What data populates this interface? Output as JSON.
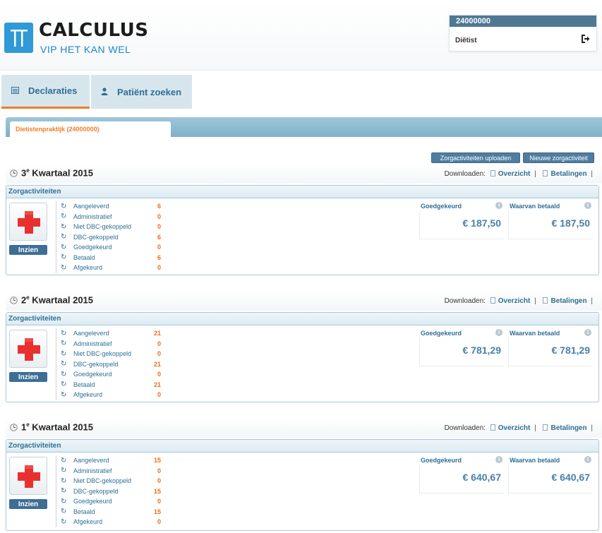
{
  "header": {
    "logo_title": "CALCULUS",
    "logo_sub_part1": "VIP",
    "logo_sub_part2": "HET KAN WEL",
    "user_id": "24000000",
    "user_role": "Diëtist",
    "logout_icon": "logout-icon"
  },
  "tabs": [
    {
      "label": "Declaraties",
      "icon": "list-icon",
      "active": true
    },
    {
      "label": "Patiënt zoeken",
      "icon": "user-icon",
      "active": false
    }
  ],
  "practice": {
    "label": "Dietistenpraktijk",
    "id": "(24000000)"
  },
  "actions": {
    "upload_label": "Zorgactiviteiten uploaden",
    "new_label": "Nieuwe zorgactiviteit"
  },
  "quarters": [
    {
      "num": "3",
      "sup": "e",
      "title": " Kwartaal 2015",
      "downloads_label": "Downloaden:",
      "overzicht": "Overzicht",
      "betalingen": "Betalingen",
      "panel_title": "Zorgactiviteiten",
      "inzien": "Inzien",
      "statuses": [
        {
          "label": "Aangeleverd",
          "value": "6"
        },
        {
          "label": "Administratief",
          "value": "0"
        },
        {
          "label": "Niet DBC-gekoppeld",
          "value": "0"
        },
        {
          "label": "DBC-gekoppeld",
          "value": "6"
        },
        {
          "label": "Goedgekeurd",
          "value": "0"
        },
        {
          "label": "Betaald",
          "value": "6"
        },
        {
          "label": "Afgekeurd",
          "value": "0"
        }
      ],
      "approved_label": "Goedgekeurd",
      "approved_amount": "€ 187,50",
      "paid_label": "Waarvan betaald",
      "paid_amount": "€ 187,50"
    },
    {
      "num": "2",
      "sup": "e",
      "title": " Kwartaal 2015",
      "downloads_label": "Downloaden:",
      "overzicht": "Overzicht",
      "betalingen": "Betalingen",
      "panel_title": "Zorgactiviteiten",
      "inzien": "Inzien",
      "statuses": [
        {
          "label": "Aangeleverd",
          "value": "21"
        },
        {
          "label": "Administratief",
          "value": "0"
        },
        {
          "label": "Niet DBC-gekoppeld",
          "value": "0"
        },
        {
          "label": "DBC-gekoppeld",
          "value": "21"
        },
        {
          "label": "Goedgekeurd",
          "value": "0"
        },
        {
          "label": "Betaald",
          "value": "21"
        },
        {
          "label": "Afgekeurd",
          "value": "0"
        }
      ],
      "approved_label": "Goedgekeurd",
      "approved_amount": "€ 781,29",
      "paid_label": "Waarvan betaald",
      "paid_amount": "€ 781,29"
    },
    {
      "num": "1",
      "sup": "e",
      "title": " Kwartaal 2015",
      "downloads_label": "Downloaden:",
      "overzicht": "Overzicht",
      "betalingen": "Betalingen",
      "panel_title": "Zorgactiviteiten",
      "inzien": "Inzien",
      "statuses": [
        {
          "label": "Aangeleverd",
          "value": "15"
        },
        {
          "label": "Administratief",
          "value": "0"
        },
        {
          "label": "Niet DBC-gekoppeld",
          "value": "0"
        },
        {
          "label": "DBC-gekoppeld",
          "value": "15"
        },
        {
          "label": "Goedgekeurd",
          "value": "0"
        },
        {
          "label": "Betaald",
          "value": "15"
        },
        {
          "label": "Afgekeurd",
          "value": "0"
        }
      ],
      "approved_label": "Goedgekeurd",
      "approved_amount": "€ 640,67",
      "paid_label": "Waarvan betaald",
      "paid_amount": "€ 640,67"
    }
  ],
  "colors": {
    "accent_orange": "#ef7d2a",
    "brand_blue": "#2f9ad6",
    "nav_blue": "#2d6f96",
    "button_blue": "#4f7da1"
  }
}
